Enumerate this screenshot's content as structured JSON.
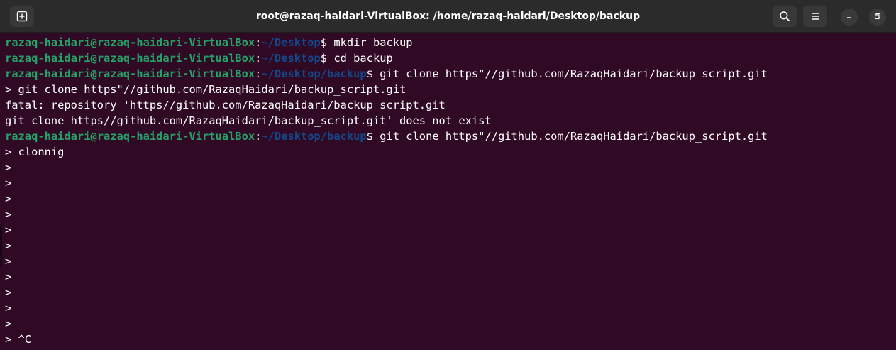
{
  "window": {
    "title": "root@razaq-haidari-VirtualBox: /home/razaq-haidari/Desktop/backup"
  },
  "icons": {
    "new_tab": "new-tab-icon",
    "search": "search-icon",
    "menu": "hamburger-menu-icon",
    "minimize": "minimize-icon",
    "maximize": "maximize-icon"
  },
  "colors": {
    "background": "#300a24",
    "prompt_user": "#26a269",
    "prompt_path": "#12488b",
    "text": "#ffffff",
    "titlebar": "#2b2b2b"
  },
  "terminal": {
    "lines": [
      {
        "type": "prompt",
        "user": "razaq-haidari@razaq-haidari-VirtualBox",
        "colon": ":",
        "path": "~/Desktop",
        "dollar": "$",
        "cmd": " mkdir backup"
      },
      {
        "type": "prompt",
        "user": "razaq-haidari@razaq-haidari-VirtualBox",
        "colon": ":",
        "path": "~/Desktop",
        "dollar": "$",
        "cmd": " cd backup"
      },
      {
        "type": "prompt",
        "user": "razaq-haidari@razaq-haidari-VirtualBox",
        "colon": ":",
        "path": "~/Desktop/backup",
        "dollar": "$",
        "cmd": " git clone https\"//github.com/RazaqHaidari/backup_script.git"
      },
      {
        "type": "text",
        "text": "> git clone https\"//github.com/RazaqHaidari/backup_script.git"
      },
      {
        "type": "text",
        "text": "fatal: repository 'https//github.com/RazaqHaidari/backup_script.git"
      },
      {
        "type": "text",
        "text": "git clone https//github.com/RazaqHaidari/backup_script.git' does not exist"
      },
      {
        "type": "prompt",
        "user": "razaq-haidari@razaq-haidari-VirtualBox",
        "colon": ":",
        "path": "~/Desktop/backup",
        "dollar": "$",
        "cmd": " git clone https\"//github.com/RazaqHaidari/backup_script.git"
      },
      {
        "type": "text",
        "text": "> clonnig"
      },
      {
        "type": "text",
        "text": ">"
      },
      {
        "type": "text",
        "text": ">"
      },
      {
        "type": "text",
        "text": ">"
      },
      {
        "type": "text",
        "text": ">"
      },
      {
        "type": "text",
        "text": ">"
      },
      {
        "type": "text",
        "text": ">"
      },
      {
        "type": "text",
        "text": ">"
      },
      {
        "type": "text",
        "text": ">"
      },
      {
        "type": "text",
        "text": ">"
      },
      {
        "type": "text",
        "text": ">"
      },
      {
        "type": "text",
        "text": ">"
      },
      {
        "type": "text",
        "text": "> ^C"
      }
    ]
  }
}
